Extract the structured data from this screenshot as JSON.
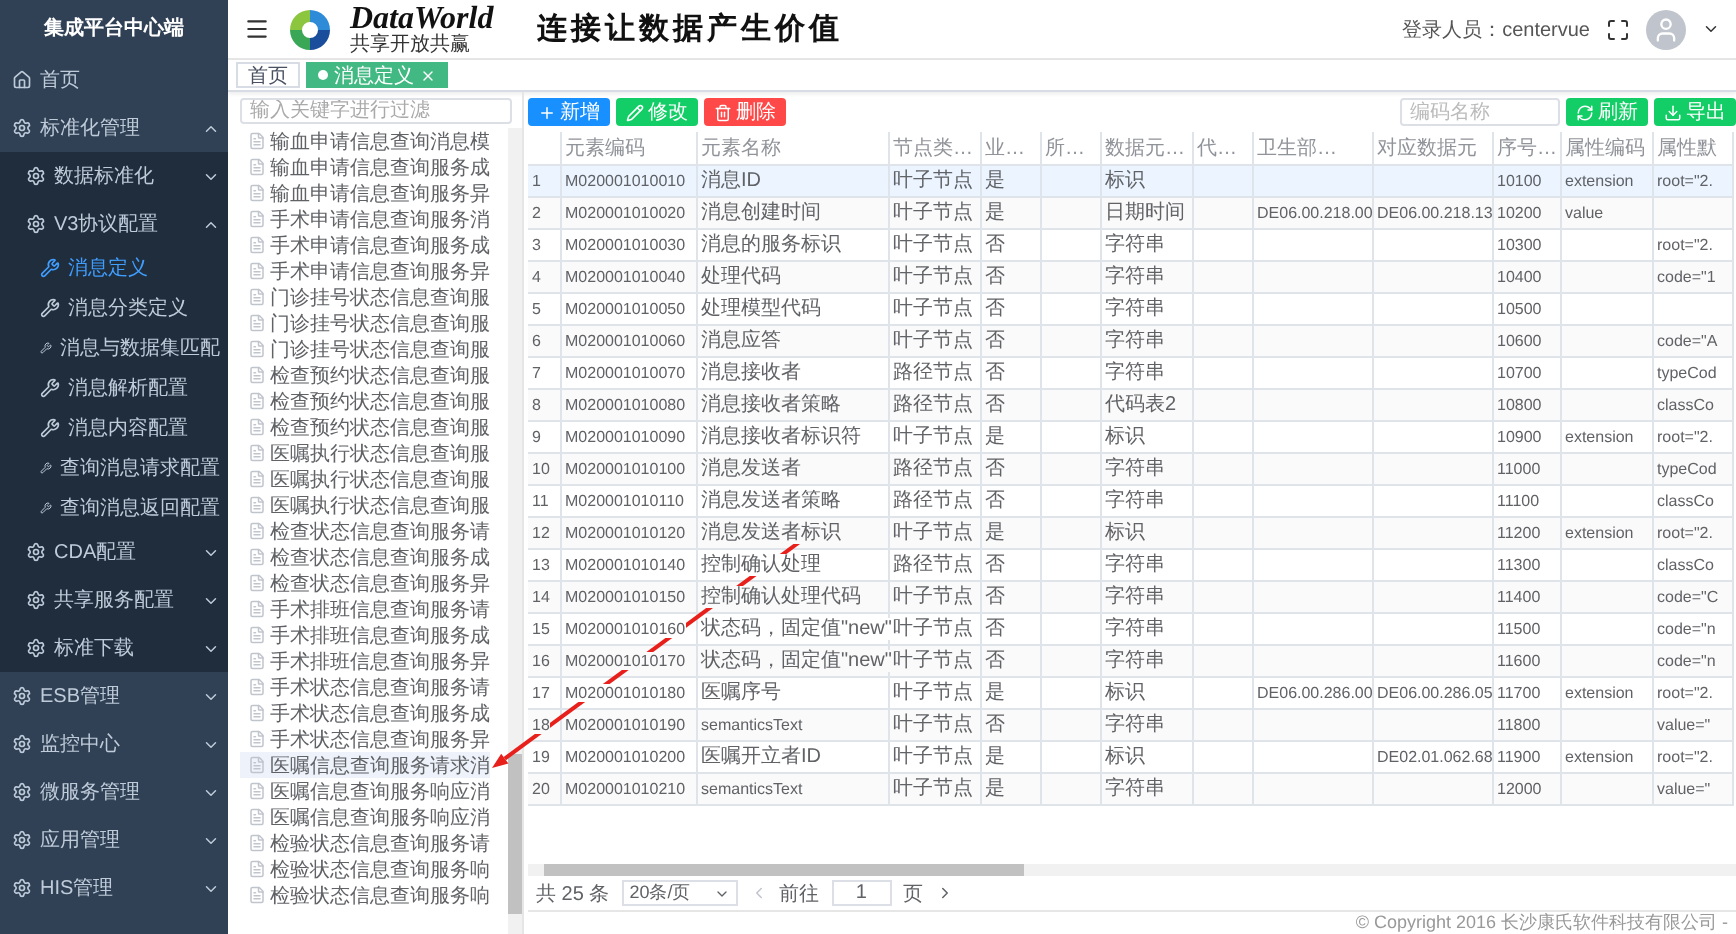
{
  "sidebar": {
    "title": "集成平台中心端",
    "items": [
      {
        "label": "首页",
        "selected": false
      },
      {
        "label": "标准化管理",
        "expanded": true,
        "selected": false,
        "children": [
          {
            "label": "数据标准化",
            "expanded": false,
            "selected": false
          },
          {
            "label": "V3协议配置",
            "expanded": true,
            "selected": false,
            "children": [
              {
                "label": "消息定义",
                "selected": true
              },
              {
                "label": "消息分类定义",
                "selected": false
              },
              {
                "label": "消息与数据集匹配",
                "selected": false
              },
              {
                "label": "消息解析配置",
                "selected": false
              },
              {
                "label": "消息内容配置",
                "selected": false
              },
              {
                "label": "查询消息请求配置",
                "selected": false
              },
              {
                "label": "查询消息返回配置",
                "selected": false
              }
            ]
          },
          {
            "label": "CDA配置",
            "expanded": false,
            "selected": false
          },
          {
            "label": "共享服务配置",
            "expanded": false,
            "selected": false
          },
          {
            "label": "标准下载",
            "expanded": false,
            "selected": false
          }
        ]
      },
      {
        "label": "ESB管理",
        "expanded": false,
        "selected": false
      },
      {
        "label": "监控中心",
        "expanded": false,
        "selected": false
      },
      {
        "label": "微服务管理",
        "expanded": false,
        "selected": false
      },
      {
        "label": "应用管理",
        "expanded": false,
        "selected": false
      },
      {
        "label": "HIS管理",
        "expanded": false,
        "selected": false
      }
    ]
  },
  "header": {
    "logo_name": "DataWorld",
    "logo_tagline": "共享开放共赢",
    "slogan": "连接让数据产生价值",
    "user_label": "登录人员：centervue"
  },
  "tabs": [
    {
      "label": "首页",
      "selected": false,
      "closable": false
    },
    {
      "label": "消息定义",
      "selected": true,
      "closable": true
    }
  ],
  "tree": {
    "filter_placeholder": "输入关键字进行过滤",
    "items": [
      {
        "label": "输血申请信息查询消息模",
        "selected": false
      },
      {
        "label": "输血申请信息查询服务成",
        "selected": false
      },
      {
        "label": "输血申请信息查询服务异",
        "selected": false
      },
      {
        "label": "手术申请信息查询服务消",
        "selected": false
      },
      {
        "label": "手术申请信息查询服务成",
        "selected": false
      },
      {
        "label": "手术申请信息查询服务异",
        "selected": false
      },
      {
        "label": "门诊挂号状态信息查询服",
        "selected": false
      },
      {
        "label": "门诊挂号状态信息查询服",
        "selected": false
      },
      {
        "label": "门诊挂号状态信息查询服",
        "selected": false
      },
      {
        "label": "检查预约状态信息查询服",
        "selected": false
      },
      {
        "label": "检查预约状态信息查询服",
        "selected": false
      },
      {
        "label": "检查预约状态信息查询服",
        "selected": false
      },
      {
        "label": "医嘱执行状态信息查询服",
        "selected": false
      },
      {
        "label": "医嘱执行状态信息查询服",
        "selected": false
      },
      {
        "label": "医嘱执行状态信息查询服",
        "selected": false
      },
      {
        "label": "检查状态信息查询服务请",
        "selected": false
      },
      {
        "label": "检查状态信息查询服务成",
        "selected": false
      },
      {
        "label": "检查状态信息查询服务异",
        "selected": false
      },
      {
        "label": "手术排班信息查询服务请",
        "selected": false
      },
      {
        "label": "手术排班信息查询服务成",
        "selected": false
      },
      {
        "label": "手术排班信息查询服务异",
        "selected": false
      },
      {
        "label": "手术状态信息查询服务请",
        "selected": false
      },
      {
        "label": "手术状态信息查询服务成",
        "selected": false
      },
      {
        "label": "手术状态信息查询服务异",
        "selected": false
      },
      {
        "label": "医嘱信息查询服务请求消",
        "selected": true
      },
      {
        "label": "医嘱信息查询服务响应消",
        "selected": false
      },
      {
        "label": "医嘱信息查询服务响应消",
        "selected": false
      },
      {
        "label": "检验状态信息查询服务请",
        "selected": false
      },
      {
        "label": "检验状态信息查询服务响",
        "selected": false
      },
      {
        "label": "检验状态信息查询服务响",
        "selected": false
      }
    ]
  },
  "toolbar": {
    "buttons": [
      {
        "label": "新增",
        "kind": "add"
      },
      {
        "label": "修改",
        "kind": "edit"
      },
      {
        "label": "删除",
        "kind": "delete"
      }
    ],
    "search_placeholder": "编码名称",
    "right_buttons": [
      {
        "label": "刷新",
        "kind": "refresh"
      },
      {
        "label": "导出",
        "kind": "export"
      }
    ]
  },
  "table": {
    "columns": [
      "元素编码",
      "元素名称",
      "节点类…",
      "业…",
      "所…",
      "数据元…",
      "代…",
      "卫生部…",
      "对应数据元",
      "序号…",
      "属性编码",
      "属性默"
    ],
    "rows": [
      {
        "index": "1",
        "selected": true,
        "cells": [
          "M020001010010",
          "消息ID",
          "叶子节点",
          "是",
          "",
          "标识",
          "",
          "",
          "",
          "10100",
          "extension",
          "root=\"2."
        ]
      },
      {
        "index": "2",
        "selected": false,
        "cells": [
          "M020001010020",
          "消息创建时间",
          "叶子节点",
          "是",
          "",
          "日期时间",
          "",
          "DE06.00.218.00",
          "DE06.00.218.13",
          "10200",
          "value",
          ""
        ]
      },
      {
        "index": "3",
        "selected": false,
        "cells": [
          "M020001010030",
          "消息的服务标识",
          "叶子节点",
          "否",
          "",
          "字符串",
          "",
          "",
          "",
          "10300",
          "",
          "root=\"2."
        ]
      },
      {
        "index": "4",
        "selected": false,
        "cells": [
          "M020001010040",
          "处理代码",
          "叶子节点",
          "否",
          "",
          "字符串",
          "",
          "",
          "",
          "10400",
          "",
          "code=\"1"
        ]
      },
      {
        "index": "5",
        "selected": false,
        "cells": [
          "M020001010050",
          "处理模型代码",
          "叶子节点",
          "否",
          "",
          "字符串",
          "",
          "",
          "",
          "10500",
          "",
          ""
        ]
      },
      {
        "index": "6",
        "selected": false,
        "cells": [
          "M020001010060",
          "消息应答",
          "叶子节点",
          "否",
          "",
          "字符串",
          "",
          "",
          "",
          "10600",
          "",
          "code=\"A"
        ]
      },
      {
        "index": "7",
        "selected": false,
        "cells": [
          "M020001010070",
          "消息接收者",
          "路径节点",
          "否",
          "",
          "字符串",
          "",
          "",
          "",
          "10700",
          "",
          "typeCod"
        ]
      },
      {
        "index": "8",
        "selected": false,
        "cells": [
          "M020001010080",
          "消息接收者策略",
          "路径节点",
          "否",
          "",
          "代码表2",
          "",
          "",
          "",
          "10800",
          "",
          "classCo"
        ]
      },
      {
        "index": "9",
        "selected": false,
        "cells": [
          "M020001010090",
          "消息接收者标识符",
          "叶子节点",
          "是",
          "",
          "标识",
          "",
          "",
          "",
          "10900",
          "extension",
          "root=\"2."
        ]
      },
      {
        "index": "10",
        "selected": false,
        "cells": [
          "M020001010100",
          "消息发送者",
          "路径节点",
          "否",
          "",
          "字符串",
          "",
          "",
          "",
          "11000",
          "",
          "typeCod"
        ]
      },
      {
        "index": "11",
        "selected": false,
        "cells": [
          "M020001010110",
          "消息发送者策略",
          "路径节点",
          "否",
          "",
          "字符串",
          "",
          "",
          "",
          "11100",
          "",
          "classCo"
        ]
      },
      {
        "index": "12",
        "selected": false,
        "cells": [
          "M020001010120",
          "消息发送者标识",
          "叶子节点",
          "是",
          "",
          "标识",
          "",
          "",
          "",
          "11200",
          "extension",
          "root=\"2."
        ]
      },
      {
        "index": "13",
        "selected": false,
        "cells": [
          "M020001010140",
          "控制确认处理",
          "路径节点",
          "否",
          "",
          "字符串",
          "",
          "",
          "",
          "11300",
          "",
          "classCo"
        ]
      },
      {
        "index": "14",
        "selected": false,
        "cells": [
          "M020001010150",
          "控制确认处理代码",
          "叶子节点",
          "否",
          "",
          "字符串",
          "",
          "",
          "",
          "11400",
          "",
          "code=\"C"
        ]
      },
      {
        "index": "15",
        "selected": false,
        "cells": [
          "M020001010160",
          "状态码，固定值\"new\"",
          "叶子节点",
          "否",
          "",
          "字符串",
          "",
          "",
          "",
          "11500",
          "",
          "code=\"n"
        ]
      },
      {
        "index": "16",
        "selected": false,
        "cells": [
          "M020001010170",
          "状态码，固定值\"new\"",
          "叶子节点",
          "否",
          "",
          "字符串",
          "",
          "",
          "",
          "11600",
          "",
          "code=\"n"
        ]
      },
      {
        "index": "17",
        "selected": false,
        "cells": [
          "M020001010180",
          "医嘱序号",
          "叶子节点",
          "是",
          "",
          "标识",
          "",
          "DE06.00.286.00",
          "DE06.00.286.05",
          "11700",
          "extension",
          "root=\"2."
        ]
      },
      {
        "index": "18",
        "selected": false,
        "cells": [
          "M020001010190",
          "semanticsText",
          "叶子节点",
          "否",
          "",
          "字符串",
          "",
          "",
          "",
          "11800",
          "",
          "value=\""
        ]
      },
      {
        "index": "19",
        "selected": false,
        "cells": [
          "M020001010200",
          "医嘱开立者ID",
          "叶子节点",
          "是",
          "",
          "标识",
          "",
          "",
          "DE02.01.062.68",
          "11900",
          "extension",
          "root=\"2."
        ]
      },
      {
        "index": "20",
        "selected": false,
        "cells": [
          "M020001010210",
          "semanticsText",
          "叶子节点",
          "是",
          "",
          "字符串",
          "",
          "",
          "",
          "12000",
          "",
          "value=\""
        ]
      }
    ]
  },
  "pagination": {
    "total": "共 25 条",
    "page_size": "20条/页",
    "goto_label": "前往",
    "page": "1",
    "page_unit": "页"
  },
  "footer": "© Copyright 2016 长沙康氏软件科技有限公司 -"
}
